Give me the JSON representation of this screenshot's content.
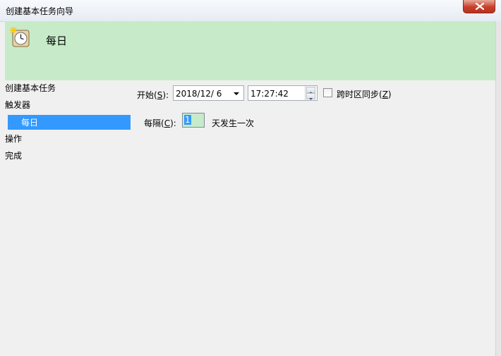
{
  "window": {
    "title": "创建基本任务向导"
  },
  "header": {
    "title": "每日",
    "icon": "clock-sun-icon"
  },
  "nav": {
    "items": [
      {
        "label": "创建基本任务"
      },
      {
        "label": "触发器"
      },
      {
        "label": "每日",
        "selected": true
      },
      {
        "label": "操作"
      },
      {
        "label": "完成"
      }
    ]
  },
  "start": {
    "label": "开始(",
    "mnemonic": "S",
    "label_end": "):",
    "date": "2018/12/  6",
    "time": "17:27:42"
  },
  "timezone_sync": {
    "label": "跨时区同步(",
    "mnemonic": "Z",
    "label_end": ")",
    "checked": false
  },
  "interval": {
    "label": "每隔(",
    "mnemonic": "C",
    "label_end": "):",
    "value": "1",
    "suffix": "天发生一次"
  },
  "colors": {
    "header_bg": "#c7ebc8",
    "selection": "#3399ff",
    "close_button": "#c7402a"
  }
}
